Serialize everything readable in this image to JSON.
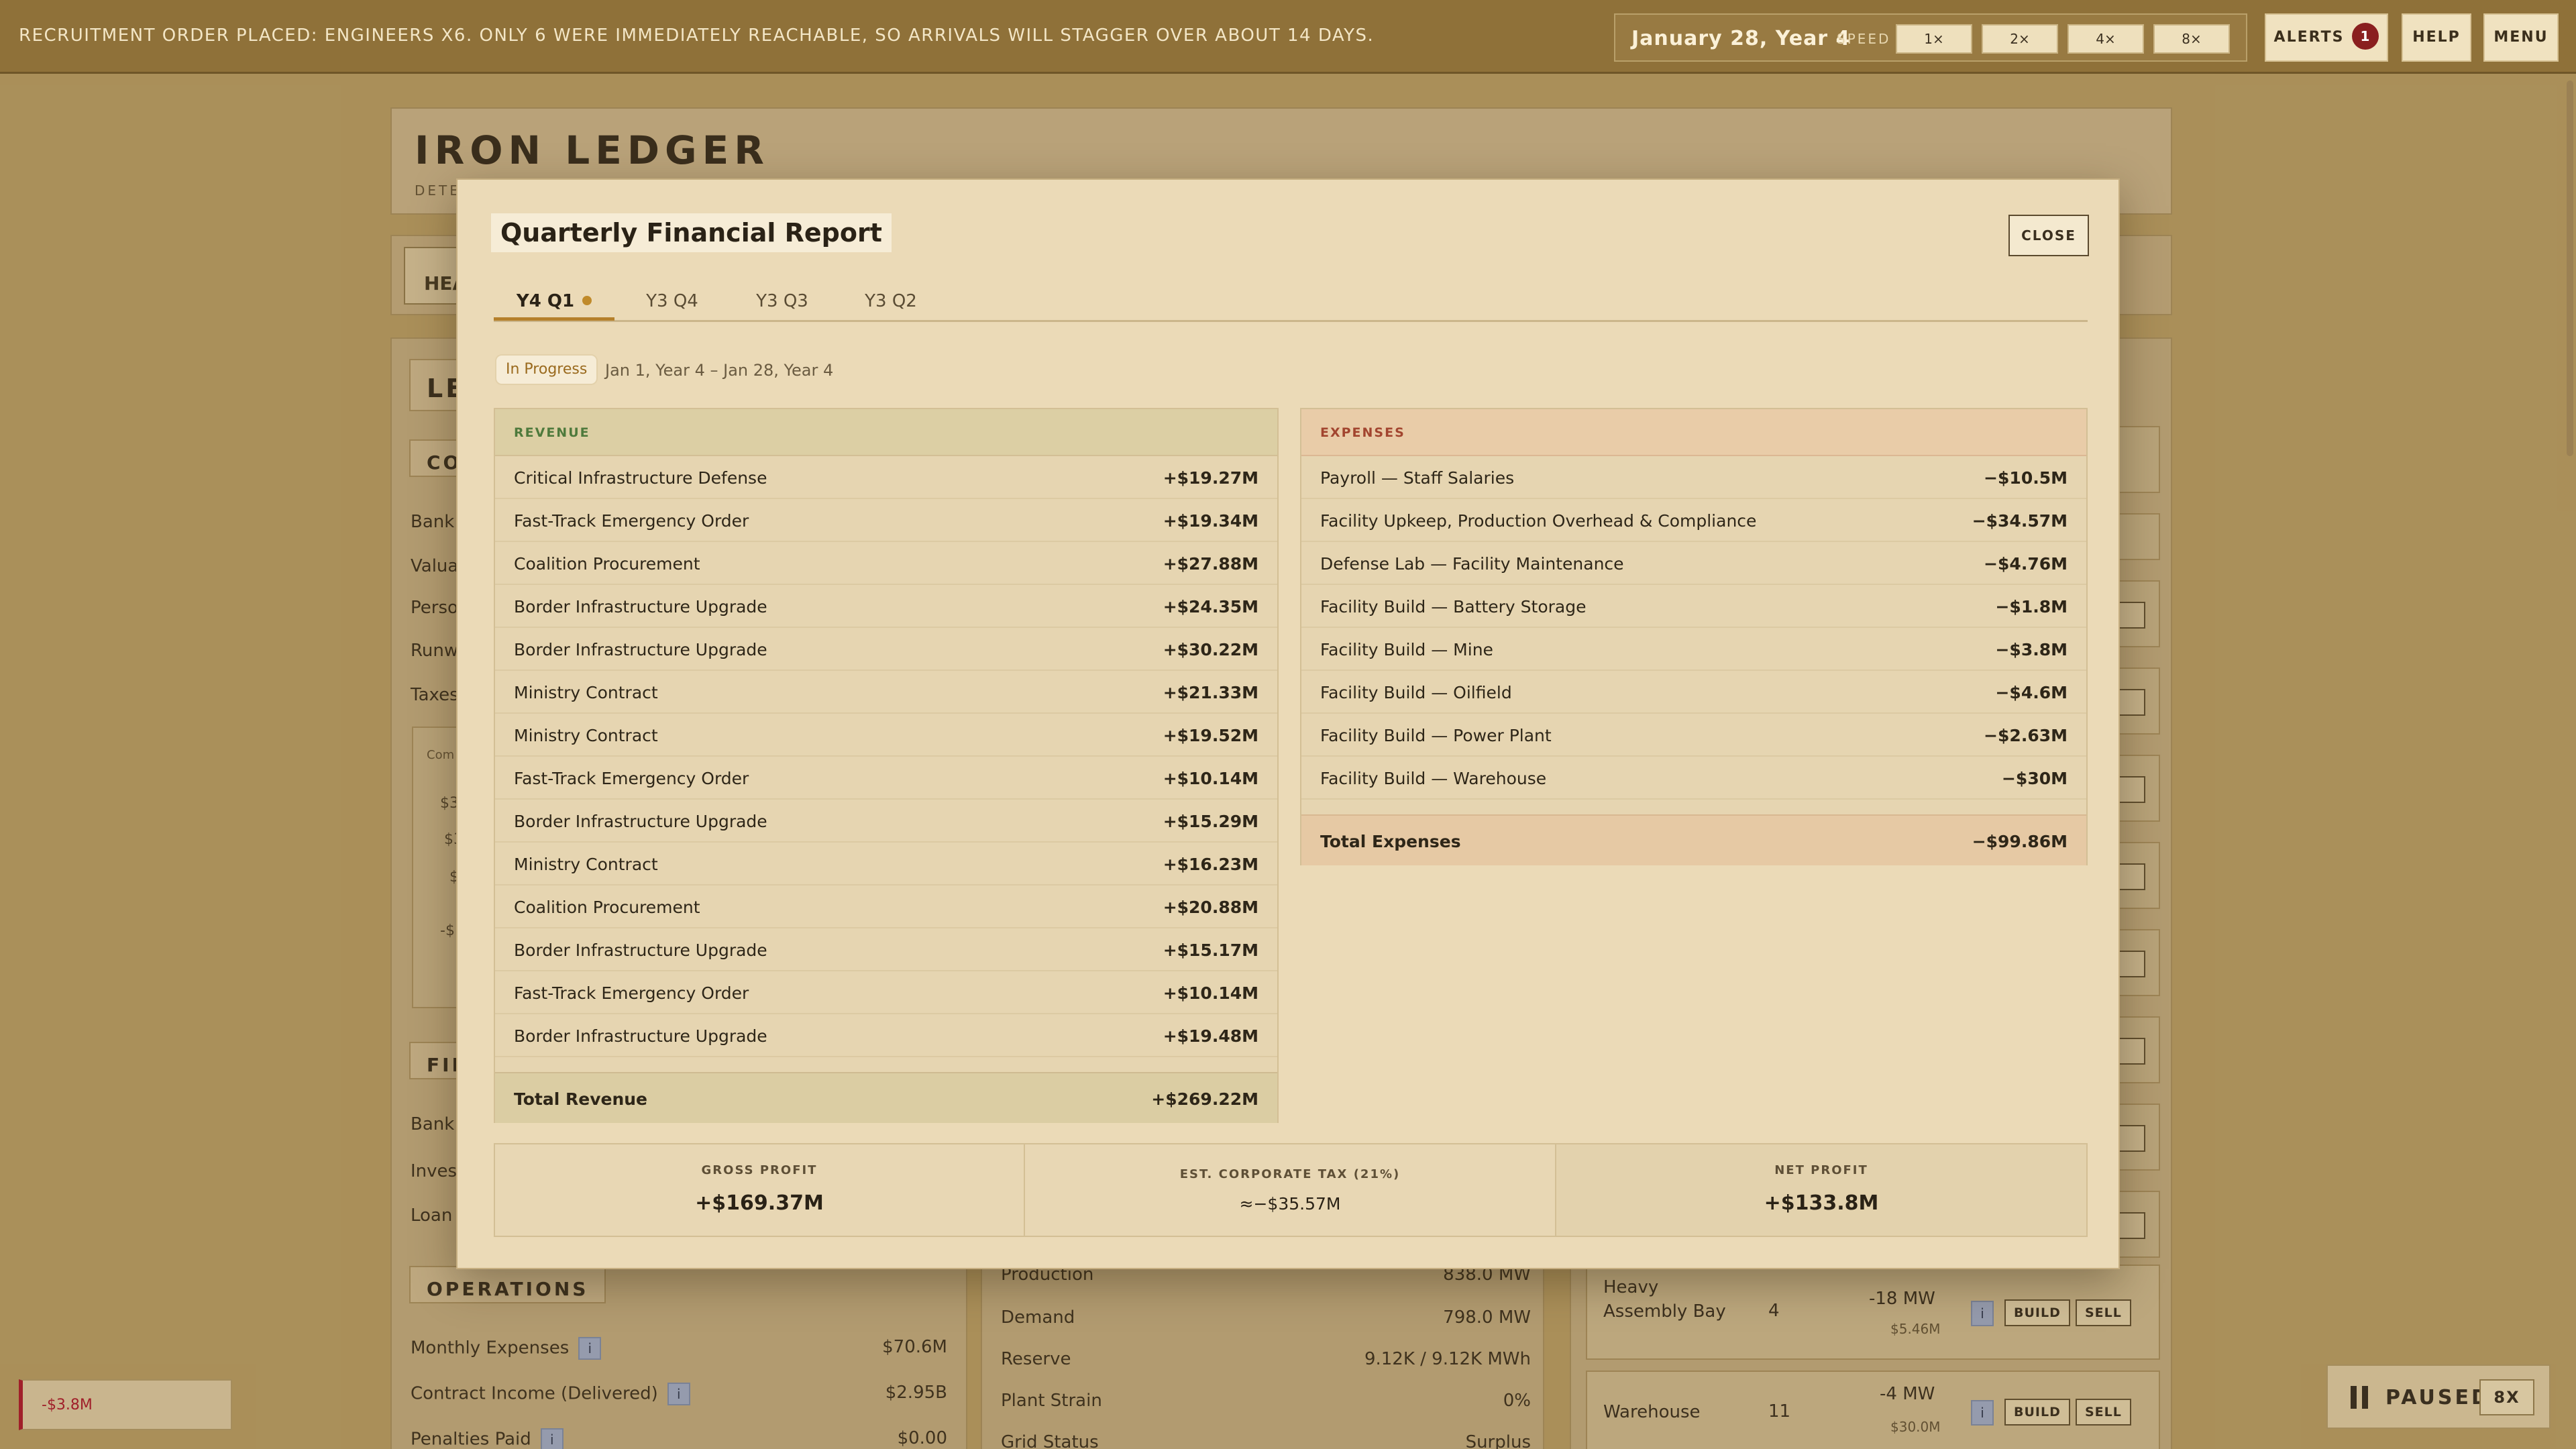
{
  "topbar": {
    "notice": "RECRUITMENT ORDER PLACED: ENGINEERS X6. ONLY 6 WERE IMMEDIATELY REACHABLE, SO ARRIVALS WILL STAGGER OVER ABOUT 14 DAYS.",
    "date": "January 28, Year 4",
    "speed_label": "SPEED",
    "speeds": [
      "1×",
      "2×",
      "4×",
      "8×"
    ],
    "alerts_label": "ALERTS",
    "alerts_count": "1",
    "help_label": "HELP",
    "menu_label": "MENU"
  },
  "background": {
    "brand": "IRON LEDGER",
    "brand_sub": "DETE",
    "tab_label": "HEA",
    "left_sections": {
      "le": "LE",
      "co": "CO",
      "fin": "FIN",
      "operations": "OPERATIONS"
    },
    "left_rows": [
      "Bank I",
      "Valuat",
      "Perso",
      "Runw",
      "Taxes"
    ],
    "comm_label": "Com",
    "comm_vals": [
      "$3",
      "$3",
      "$",
      "-$"
    ],
    "fin_rows": [
      "Bank I",
      "Invest",
      "Loan I"
    ],
    "ops_rows": [
      {
        "label": "Monthly Expenses",
        "value": "$70.6M"
      },
      {
        "label": "Contract Income (Delivered)",
        "value": "$2.95B"
      },
      {
        "label": "Penalties Paid",
        "value": "$0.00"
      }
    ],
    "mid_rows": [
      {
        "label": "Production",
        "value": "838.0 MW"
      },
      {
        "label": "Demand",
        "value": "798.0 MW"
      },
      {
        "label": "Reserve",
        "value": "9.12K / 9.12K MWh"
      },
      {
        "label": "Plant Strain",
        "value": "0%"
      },
      {
        "label": "Grid Status",
        "value": "Surplus"
      }
    ],
    "facilities": [
      {
        "name": "Heavy Assembly Bay",
        "count": "4",
        "mw": "-18 MW",
        "cost": "$5.46M"
      },
      {
        "name": "Warehouse",
        "count": "11",
        "mw": "-4 MW",
        "cost": "$30.0M"
      }
    ],
    "build_label": "BUILD",
    "sell_label": "SELL",
    "info_glyph": "i"
  },
  "toast": {
    "text": "-$3.8M"
  },
  "paused": {
    "label": "PAUSED",
    "speed": "8X"
  },
  "modal": {
    "title": "Quarterly Financial Report",
    "close_label": "CLOSE",
    "tabs": [
      "Y4 Q1",
      "Y3 Q4",
      "Y3 Q3",
      "Y3 Q2"
    ],
    "status": "In Progress",
    "range": "Jan 1, Year 4 – Jan 28, Year 4",
    "revenue": {
      "header": "REVENUE",
      "rows": [
        {
          "label": "Critical Infrastructure Defense",
          "amount": "+$19.27M"
        },
        {
          "label": "Fast-Track Emergency Order",
          "amount": "+$19.34M"
        },
        {
          "label": "Coalition Procurement",
          "amount": "+$27.88M"
        },
        {
          "label": "Border Infrastructure Upgrade",
          "amount": "+$24.35M"
        },
        {
          "label": "Border Infrastructure Upgrade",
          "amount": "+$30.22M"
        },
        {
          "label": "Ministry Contract",
          "amount": "+$21.33M"
        },
        {
          "label": "Ministry Contract",
          "amount": "+$19.52M"
        },
        {
          "label": "Fast-Track Emergency Order",
          "amount": "+$10.14M"
        },
        {
          "label": "Border Infrastructure Upgrade",
          "amount": "+$15.29M"
        },
        {
          "label": "Ministry Contract",
          "amount": "+$16.23M"
        },
        {
          "label": "Coalition Procurement",
          "amount": "+$20.88M"
        },
        {
          "label": "Border Infrastructure Upgrade",
          "amount": "+$15.17M"
        },
        {
          "label": "Fast-Track Emergency Order",
          "amount": "+$10.14M"
        },
        {
          "label": "Border Infrastructure Upgrade",
          "amount": "+$19.48M"
        }
      ],
      "total_label": "Total Revenue",
      "total": "+$269.22M"
    },
    "expenses": {
      "header": "EXPENSES",
      "rows": [
        {
          "label": "Payroll — Staff Salaries",
          "amount": "−$10.5M"
        },
        {
          "label": "Facility Upkeep, Production Overhead & Compliance",
          "amount": "−$34.57M"
        },
        {
          "label": "Defense Lab — Facility Maintenance",
          "amount": "−$4.76M"
        },
        {
          "label": "Facility Build — Battery Storage",
          "amount": "−$1.8M"
        },
        {
          "label": "Facility Build — Mine",
          "amount": "−$3.8M"
        },
        {
          "label": "Facility Build — Oilfield",
          "amount": "−$4.6M"
        },
        {
          "label": "Facility Build — Power Plant",
          "amount": "−$2.63M"
        },
        {
          "label": "Facility Build — Warehouse",
          "amount": "−$30M"
        }
      ],
      "total_label": "Total Expenses",
      "total": "−$99.86M"
    },
    "summary": [
      {
        "label": "GROSS PROFIT",
        "value": "+$169.37M"
      },
      {
        "label": "EST. CORPORATE TAX (21%)",
        "value": "≈−$35.57M"
      },
      {
        "label": "NET PROFIT",
        "value": "+$133.8M"
      }
    ]
  }
}
